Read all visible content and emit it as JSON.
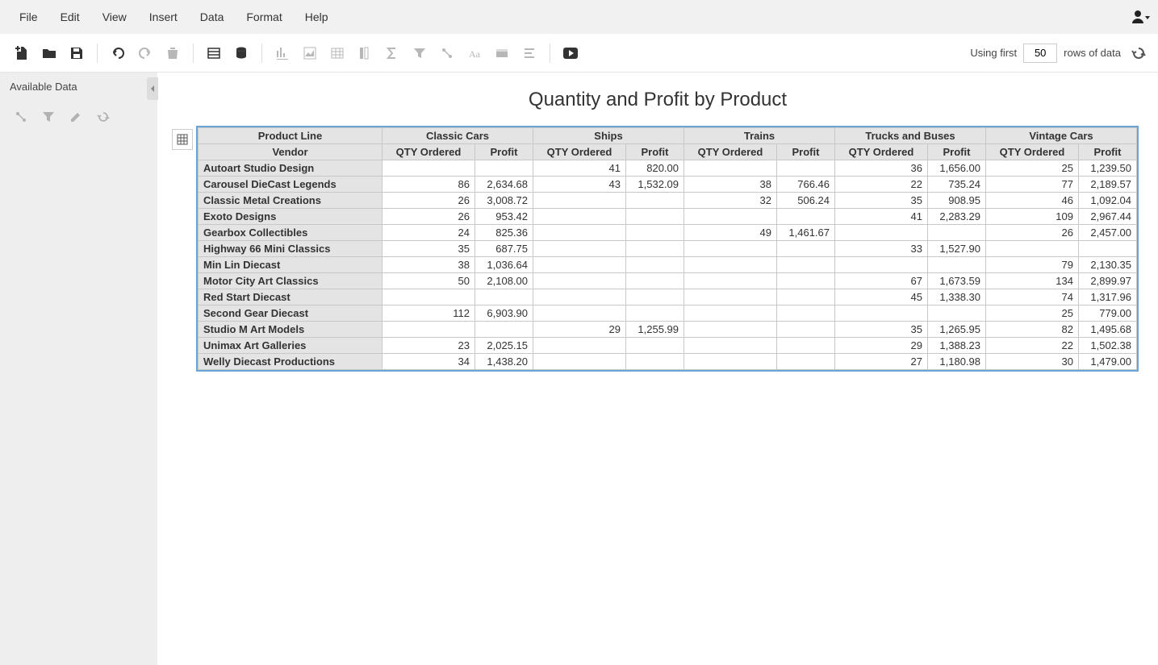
{
  "menu": {
    "items": [
      "File",
      "Edit",
      "View",
      "Insert",
      "Data",
      "Format",
      "Help"
    ]
  },
  "toolbar": {
    "using_first": "Using first",
    "rows_value": "50",
    "rows_of_data": "rows of data"
  },
  "sidebar": {
    "title": "Available Data"
  },
  "report": {
    "title": "Quantity and Profit by Product",
    "corner_top": "Product Line",
    "corner_bottom": "Vendor",
    "measures": [
      "QTY Ordered",
      "Profit"
    ],
    "product_lines": [
      "Classic Cars",
      "Ships",
      "Trains",
      "Trucks and Buses",
      "Vintage Cars"
    ],
    "rows": [
      {
        "vendor": "Autoart Studio Design",
        "cells": [
          "",
          "",
          "41",
          "820.00",
          "",
          "",
          "36",
          "1,656.00",
          "25",
          "1,239.50"
        ]
      },
      {
        "vendor": "Carousel DieCast Legends",
        "cells": [
          "86",
          "2,634.68",
          "43",
          "1,532.09",
          "38",
          "766.46",
          "22",
          "735.24",
          "77",
          "2,189.57"
        ]
      },
      {
        "vendor": "Classic Metal Creations",
        "cells": [
          "26",
          "3,008.72",
          "",
          "",
          "32",
          "506.24",
          "35",
          "908.95",
          "46",
          "1,092.04"
        ]
      },
      {
        "vendor": "Exoto Designs",
        "cells": [
          "26",
          "953.42",
          "",
          "",
          "",
          "",
          "41",
          "2,283.29",
          "109",
          "2,967.44"
        ]
      },
      {
        "vendor": "Gearbox Collectibles",
        "cells": [
          "24",
          "825.36",
          "",
          "",
          "49",
          "1,461.67",
          "",
          "",
          "26",
          "2,457.00"
        ]
      },
      {
        "vendor": "Highway 66 Mini Classics",
        "cells": [
          "35",
          "687.75",
          "",
          "",
          "",
          "",
          "33",
          "1,527.90",
          "",
          ""
        ]
      },
      {
        "vendor": "Min Lin Diecast",
        "cells": [
          "38",
          "1,036.64",
          "",
          "",
          "",
          "",
          "",
          "",
          "79",
          "2,130.35"
        ]
      },
      {
        "vendor": "Motor City Art Classics",
        "cells": [
          "50",
          "2,108.00",
          "",
          "",
          "",
          "",
          "67",
          "1,673.59",
          "134",
          "2,899.97"
        ]
      },
      {
        "vendor": "Red Start Diecast",
        "cells": [
          "",
          "",
          "",
          "",
          "",
          "",
          "45",
          "1,338.30",
          "74",
          "1,317.96"
        ]
      },
      {
        "vendor": "Second Gear Diecast",
        "cells": [
          "112",
          "6,903.90",
          "",
          "",
          "",
          "",
          "",
          "",
          "25",
          "779.00"
        ]
      },
      {
        "vendor": "Studio M Art Models",
        "cells": [
          "",
          "",
          "29",
          "1,255.99",
          "",
          "",
          "35",
          "1,265.95",
          "82",
          "1,495.68"
        ]
      },
      {
        "vendor": "Unimax Art Galleries",
        "cells": [
          "23",
          "2,025.15",
          "",
          "",
          "",
          "",
          "29",
          "1,388.23",
          "22",
          "1,502.38"
        ]
      },
      {
        "vendor": "Welly Diecast Productions",
        "cells": [
          "34",
          "1,438.20",
          "",
          "",
          "",
          "",
          "27",
          "1,180.98",
          "30",
          "1,479.00"
        ]
      }
    ]
  },
  "chart_data": {
    "type": "table",
    "title": "Quantity and Profit by Product",
    "row_dimension": "Vendor",
    "column_dimension": "Product Line",
    "measures": [
      "QTY Ordered",
      "Profit"
    ],
    "columns": [
      "Classic Cars",
      "Ships",
      "Trains",
      "Trucks and Buses",
      "Vintage Cars"
    ],
    "rows": [
      {
        "vendor": "Autoart Studio Design",
        "Classic Cars": {},
        "Ships": {
          "qty": 41,
          "profit": 820.0
        },
        "Trains": {},
        "Trucks and Buses": {
          "qty": 36,
          "profit": 1656.0
        },
        "Vintage Cars": {
          "qty": 25,
          "profit": 1239.5
        }
      },
      {
        "vendor": "Carousel DieCast Legends",
        "Classic Cars": {
          "qty": 86,
          "profit": 2634.68
        },
        "Ships": {
          "qty": 43,
          "profit": 1532.09
        },
        "Trains": {
          "qty": 38,
          "profit": 766.46
        },
        "Trucks and Buses": {
          "qty": 22,
          "profit": 735.24
        },
        "Vintage Cars": {
          "qty": 77,
          "profit": 2189.57
        }
      },
      {
        "vendor": "Classic Metal Creations",
        "Classic Cars": {
          "qty": 26,
          "profit": 3008.72
        },
        "Ships": {},
        "Trains": {
          "qty": 32,
          "profit": 506.24
        },
        "Trucks and Buses": {
          "qty": 35,
          "profit": 908.95
        },
        "Vintage Cars": {
          "qty": 46,
          "profit": 1092.04
        }
      },
      {
        "vendor": "Exoto Designs",
        "Classic Cars": {
          "qty": 26,
          "profit": 953.42
        },
        "Ships": {},
        "Trains": {},
        "Trucks and Buses": {
          "qty": 41,
          "profit": 2283.29
        },
        "Vintage Cars": {
          "qty": 109,
          "profit": 2967.44
        }
      },
      {
        "vendor": "Gearbox Collectibles",
        "Classic Cars": {
          "qty": 24,
          "profit": 825.36
        },
        "Ships": {},
        "Trains": {
          "qty": 49,
          "profit": 1461.67
        },
        "Trucks and Buses": {},
        "Vintage Cars": {
          "qty": 26,
          "profit": 2457.0
        }
      },
      {
        "vendor": "Highway 66 Mini Classics",
        "Classic Cars": {
          "qty": 35,
          "profit": 687.75
        },
        "Ships": {},
        "Trains": {},
        "Trucks and Buses": {
          "qty": 33,
          "profit": 1527.9
        },
        "Vintage Cars": {}
      },
      {
        "vendor": "Min Lin Diecast",
        "Classic Cars": {
          "qty": 38,
          "profit": 1036.64
        },
        "Ships": {},
        "Trains": {},
        "Trucks and Buses": {},
        "Vintage Cars": {
          "qty": 79,
          "profit": 2130.35
        }
      },
      {
        "vendor": "Motor City Art Classics",
        "Classic Cars": {
          "qty": 50,
          "profit": 2108.0
        },
        "Ships": {},
        "Trains": {},
        "Trucks and Buses": {
          "qty": 67,
          "profit": 1673.59
        },
        "Vintage Cars": {
          "qty": 134,
          "profit": 2899.97
        }
      },
      {
        "vendor": "Red Start Diecast",
        "Classic Cars": {},
        "Ships": {},
        "Trains": {},
        "Trucks and Buses": {
          "qty": 45,
          "profit": 1338.3
        },
        "Vintage Cars": {
          "qty": 74,
          "profit": 1317.96
        }
      },
      {
        "vendor": "Second Gear Diecast",
        "Classic Cars": {
          "qty": 112,
          "profit": 6903.9
        },
        "Ships": {},
        "Trains": {},
        "Trucks and Buses": {},
        "Vintage Cars": {
          "qty": 25,
          "profit": 779.0
        }
      },
      {
        "vendor": "Studio M Art Models",
        "Classic Cars": {},
        "Ships": {
          "qty": 29,
          "profit": 1255.99
        },
        "Trains": {},
        "Trucks and Buses": {
          "qty": 35,
          "profit": 1265.95
        },
        "Vintage Cars": {
          "qty": 82,
          "profit": 1495.68
        }
      },
      {
        "vendor": "Unimax Art Galleries",
        "Classic Cars": {
          "qty": 23,
          "profit": 2025.15
        },
        "Ships": {},
        "Trains": {},
        "Trucks and Buses": {
          "qty": 29,
          "profit": 1388.23
        },
        "Vintage Cars": {
          "qty": 22,
          "profit": 1502.38
        }
      },
      {
        "vendor": "Welly Diecast Productions",
        "Classic Cars": {
          "qty": 34,
          "profit": 1438.2
        },
        "Ships": {},
        "Trains": {},
        "Trucks and Buses": {
          "qty": 27,
          "profit": 1180.98
        },
        "Vintage Cars": {
          "qty": 30,
          "profit": 1479.0
        }
      }
    ]
  }
}
